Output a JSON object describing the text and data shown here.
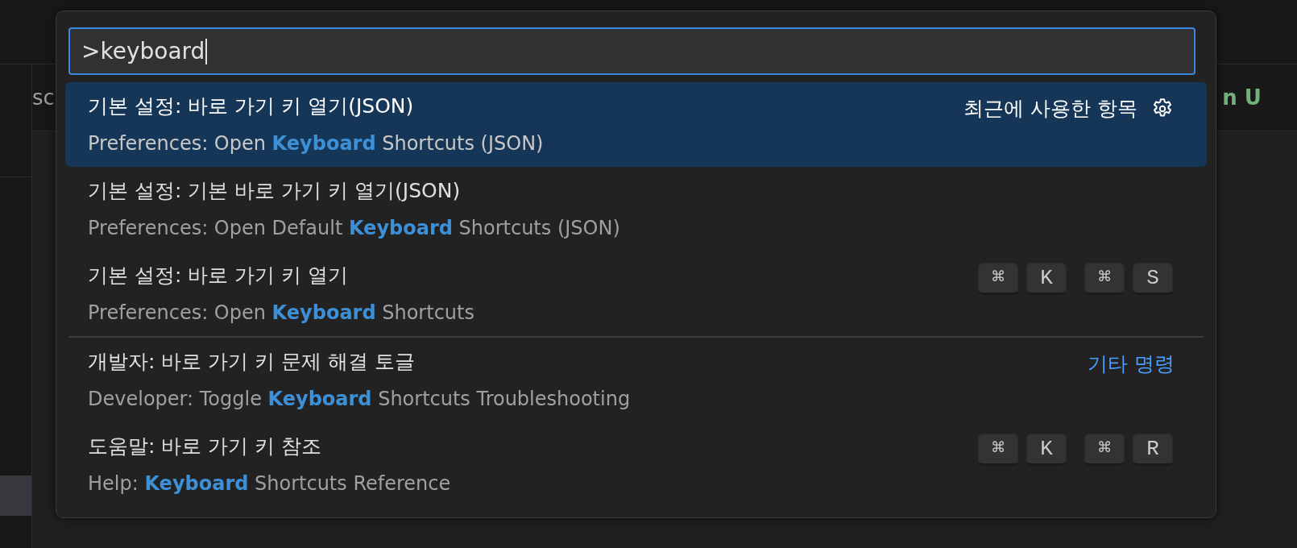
{
  "editor": {
    "tab_fragments": [
      {
        "text": "sc",
        "color": "#9d9d9d"
      },
      {
        "text": "n U",
        "color": "#73b17a"
      }
    ]
  },
  "command_palette": {
    "input": {
      "value": ">keyboard"
    },
    "items": [
      {
        "label": "기본 설정: 바로 가기 키 열기(JSON)",
        "detail": "Preferences: Open **Keyboard** Shortcuts (JSON)",
        "selected": true,
        "separator_before": false,
        "kind": "recent",
        "aside": "최근에 사용한 항목"
      },
      {
        "label": "기본 설정: 기본 바로 가기 키 열기(JSON)",
        "detail": "Preferences: Open Default **Keyboard** Shortcuts (JSON)",
        "selected": false,
        "separator_before": false,
        "kind": "plain"
      },
      {
        "label": "기본 설정: 바로 가기 키 열기",
        "detail": "Preferences: Open **Keyboard** Shortcuts",
        "selected": false,
        "separator_before": false,
        "kind": "keys",
        "chords": [
          [
            "⌘",
            "K"
          ],
          [
            "⌘",
            "S"
          ]
        ]
      },
      {
        "label": "개발자: 바로 가기 키 문제 해결 토글",
        "detail": "Developer: Toggle **Keyboard** Shortcuts Troubleshooting",
        "selected": false,
        "separator_before": true,
        "kind": "link",
        "aside": "기타 명령"
      },
      {
        "label": "도움말: 바로 가기 키 참조",
        "detail": "Help: **Keyboard** Shortcuts Reference",
        "selected": false,
        "separator_before": false,
        "kind": "keys",
        "chords": [
          [
            "⌘",
            "K"
          ],
          [
            "⌘",
            "R"
          ]
        ]
      }
    ]
  }
}
